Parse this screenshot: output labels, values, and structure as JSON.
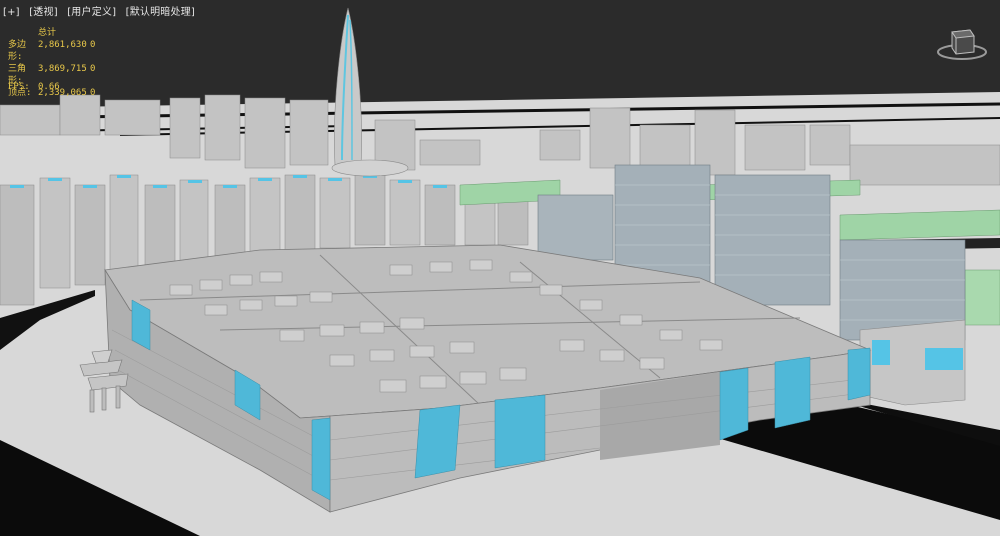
{
  "viewport": {
    "labels": [
      "[+]",
      "[透视]",
      "[用户定义]",
      "[默认明暗处理]"
    ]
  },
  "stats": {
    "header": "总计",
    "rows": [
      {
        "label": "多边形:",
        "value": "2,861,630",
        "selected": "0"
      },
      {
        "label": "三角形:",
        "value": "3,869,715",
        "selected": "0"
      },
      {
        "label": "顶点:",
        "value": "2,339,065",
        "selected": "0"
      }
    ],
    "fps_label": "FPS:",
    "fps_value": "0.66"
  },
  "colors": {
    "background": "#2b2b2b",
    "ground": "#d6d6d6",
    "roads": "#0e0e0e",
    "building": "#b9b9b9",
    "glass_accent": "#4fb8d8",
    "green_roof": "#9fd4a6",
    "stats_text": "#e8c84a"
  },
  "viewcube_icon": "viewcube-icon"
}
